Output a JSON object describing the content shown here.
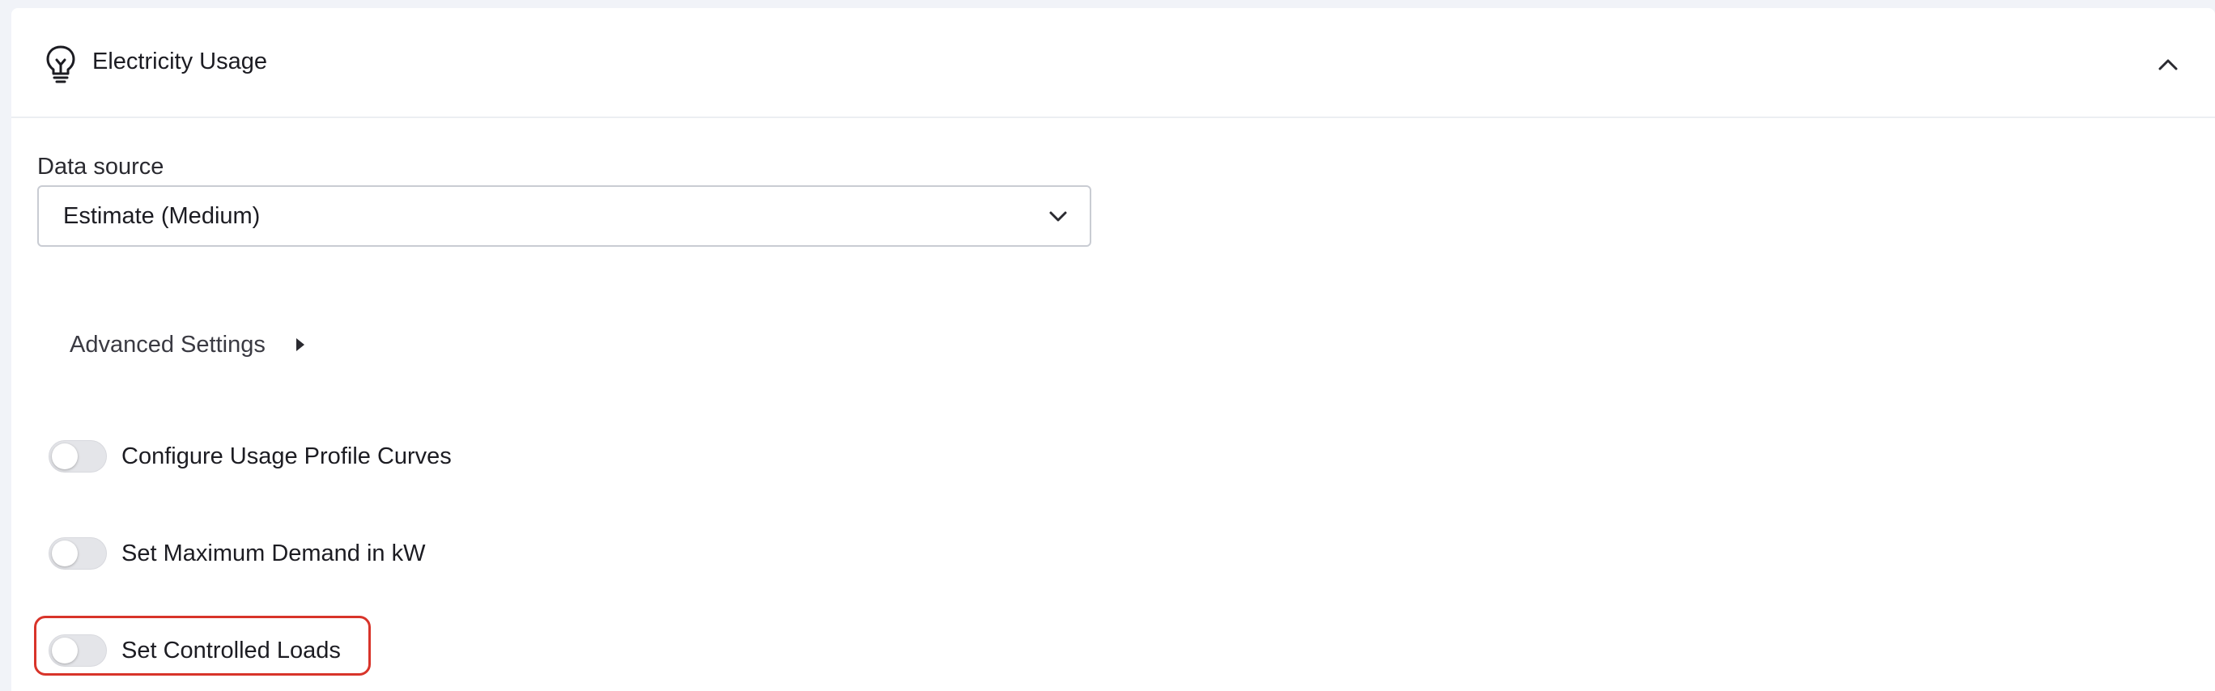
{
  "section": {
    "title": "Electricity Usage",
    "icon": "lightbulb-icon",
    "collapse_icon": "chevron-up-icon"
  },
  "data_source": {
    "label": "Data source",
    "selected": "Estimate (Medium)",
    "chevron_icon": "chevron-down-icon"
  },
  "advanced": {
    "label": "Advanced Settings",
    "caret_icon": "caret-right-icon"
  },
  "toggles": [
    {
      "label": "Configure Usage Profile Curves",
      "on": false
    },
    {
      "label": "Set Maximum Demand in kW",
      "on": false
    },
    {
      "label": "Set Controlled Loads",
      "on": false,
      "highlighted": true
    }
  ],
  "colors": {
    "highlight": "#d8342a",
    "switch_off": "#e4e5e9",
    "page_bg": "#f1f3f8"
  }
}
